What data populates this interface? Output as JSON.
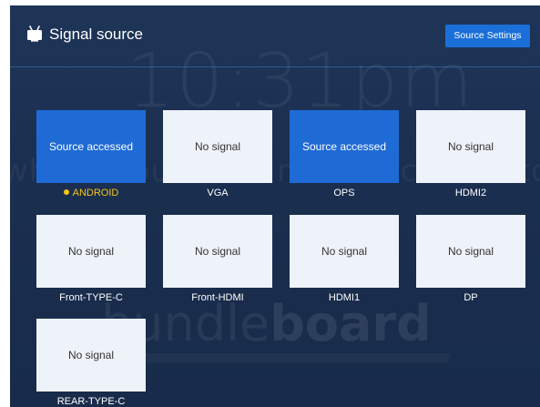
{
  "header": {
    "title": "Signal source",
    "settings_button": "Source Settings",
    "title_icon": "tv-icon"
  },
  "wallpaper": {
    "time": "10:31pm",
    "subtitle": "what should our main focus be today",
    "brand_light": "bundle",
    "brand_bold": "board"
  },
  "sources": [
    {
      "name": "ANDROID",
      "status": "Source accessed",
      "current": true
    },
    {
      "name": "VGA",
      "status": "No signal",
      "current": false
    },
    {
      "name": "OPS",
      "status": "Source accessed",
      "current": false
    },
    {
      "name": "HDMI2",
      "status": "No signal",
      "current": false
    },
    {
      "name": "Front-TYPE-C",
      "status": "No signal",
      "current": false
    },
    {
      "name": "Front-HDMI",
      "status": "No signal",
      "current": false
    },
    {
      "name": "HDMI1",
      "status": "No signal",
      "current": false
    },
    {
      "name": "DP",
      "status": "No signal",
      "current": false
    },
    {
      "name": "REAR-TYPE-C",
      "status": "No signal",
      "current": false
    }
  ],
  "colors": {
    "active_tile": "#1e6bd6",
    "idle_tile": "#eef2f9",
    "current_indicator": "#f5c518",
    "background": "#1c3050"
  }
}
